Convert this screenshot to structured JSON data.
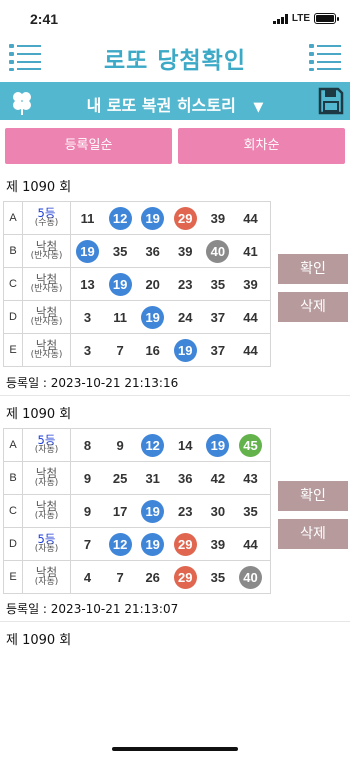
{
  "status": {
    "time": "2:41",
    "network": "LTE"
  },
  "header": {
    "title": "로또 당첨확인",
    "left_icon": "list-icon",
    "right_icon": "list-icon"
  },
  "subbar": {
    "title": "내 로또 복권 히스토리",
    "dropdown": "▼",
    "left_icon": "clover-icon",
    "right_icon": "save-icon"
  },
  "sort": {
    "by_registration": "등록일순",
    "by_round": "회차순"
  },
  "colors": {
    "accent": "#3ca9c6",
    "bar": "#52b7cf",
    "pink": "#ec83b0",
    "action": "#b69a9c",
    "ball_blue": "#3f85d8",
    "ball_red": "#e0664f",
    "ball_gray": "#8a8a8a",
    "ball_green": "#63b24c"
  },
  "actions": {
    "confirm": "확인",
    "delete": "삭제"
  },
  "tickets": [
    {
      "round": "제 1090 회",
      "registered": "등록일 : 2023-10-21 21:13:16",
      "games": [
        {
          "label": "A",
          "result": "5등",
          "mode": "(수동)",
          "win": true,
          "numbers": [
            [
              "11",
              ""
            ],
            [
              "12",
              "blue"
            ],
            [
              "19",
              "blue"
            ],
            [
              "29",
              "red"
            ],
            [
              "39",
              ""
            ],
            [
              "44",
              ""
            ]
          ]
        },
        {
          "label": "B",
          "result": "낙첨",
          "mode": "(반자동)",
          "win": false,
          "numbers": [
            [
              "19",
              "blue"
            ],
            [
              "35",
              ""
            ],
            [
              "36",
              ""
            ],
            [
              "39",
              ""
            ],
            [
              "40",
              "gray"
            ],
            [
              "41",
              ""
            ]
          ]
        },
        {
          "label": "C",
          "result": "낙첨",
          "mode": "(반자동)",
          "win": false,
          "numbers": [
            [
              "13",
              ""
            ],
            [
              "19",
              "blue"
            ],
            [
              "20",
              ""
            ],
            [
              "23",
              ""
            ],
            [
              "35",
              ""
            ],
            [
              "39",
              ""
            ]
          ]
        },
        {
          "label": "D",
          "result": "낙첨",
          "mode": "(반자동)",
          "win": false,
          "numbers": [
            [
              "3",
              ""
            ],
            [
              "11",
              ""
            ],
            [
              "19",
              "blue"
            ],
            [
              "24",
              ""
            ],
            [
              "37",
              ""
            ],
            [
              "44",
              ""
            ]
          ]
        },
        {
          "label": "E",
          "result": "낙첨",
          "mode": "(반자동)",
          "win": false,
          "numbers": [
            [
              "3",
              ""
            ],
            [
              "7",
              ""
            ],
            [
              "16",
              ""
            ],
            [
              "19",
              "blue"
            ],
            [
              "37",
              ""
            ],
            [
              "44",
              ""
            ]
          ]
        }
      ]
    },
    {
      "round": "제 1090 회",
      "registered": "등록일 : 2023-10-21 21:13:07",
      "games": [
        {
          "label": "A",
          "result": "5등",
          "mode": "(자동)",
          "win": true,
          "numbers": [
            [
              "8",
              ""
            ],
            [
              "9",
              ""
            ],
            [
              "12",
              "blue"
            ],
            [
              "14",
              ""
            ],
            [
              "19",
              "blue"
            ],
            [
              "45",
              "green"
            ]
          ]
        },
        {
          "label": "B",
          "result": "낙첨",
          "mode": "(자동)",
          "win": false,
          "numbers": [
            [
              "9",
              ""
            ],
            [
              "25",
              ""
            ],
            [
              "31",
              ""
            ],
            [
              "36",
              ""
            ],
            [
              "42",
              ""
            ],
            [
              "43",
              ""
            ]
          ]
        },
        {
          "label": "C",
          "result": "낙첨",
          "mode": "(자동)",
          "win": false,
          "numbers": [
            [
              "9",
              ""
            ],
            [
              "17",
              ""
            ],
            [
              "19",
              "blue"
            ],
            [
              "23",
              ""
            ],
            [
              "30",
              ""
            ],
            [
              "35",
              ""
            ]
          ]
        },
        {
          "label": "D",
          "result": "5등",
          "mode": "(자동)",
          "win": true,
          "numbers": [
            [
              "7",
              ""
            ],
            [
              "12",
              "blue"
            ],
            [
              "19",
              "blue"
            ],
            [
              "29",
              "red"
            ],
            [
              "39",
              ""
            ],
            [
              "44",
              ""
            ]
          ]
        },
        {
          "label": "E",
          "result": "낙첨",
          "mode": "(자동)",
          "win": false,
          "numbers": [
            [
              "4",
              ""
            ],
            [
              "7",
              ""
            ],
            [
              "26",
              ""
            ],
            [
              "29",
              "red"
            ],
            [
              "35",
              ""
            ],
            [
              "40",
              "gray"
            ]
          ]
        }
      ]
    },
    {
      "round": "제 1090 회"
    }
  ]
}
